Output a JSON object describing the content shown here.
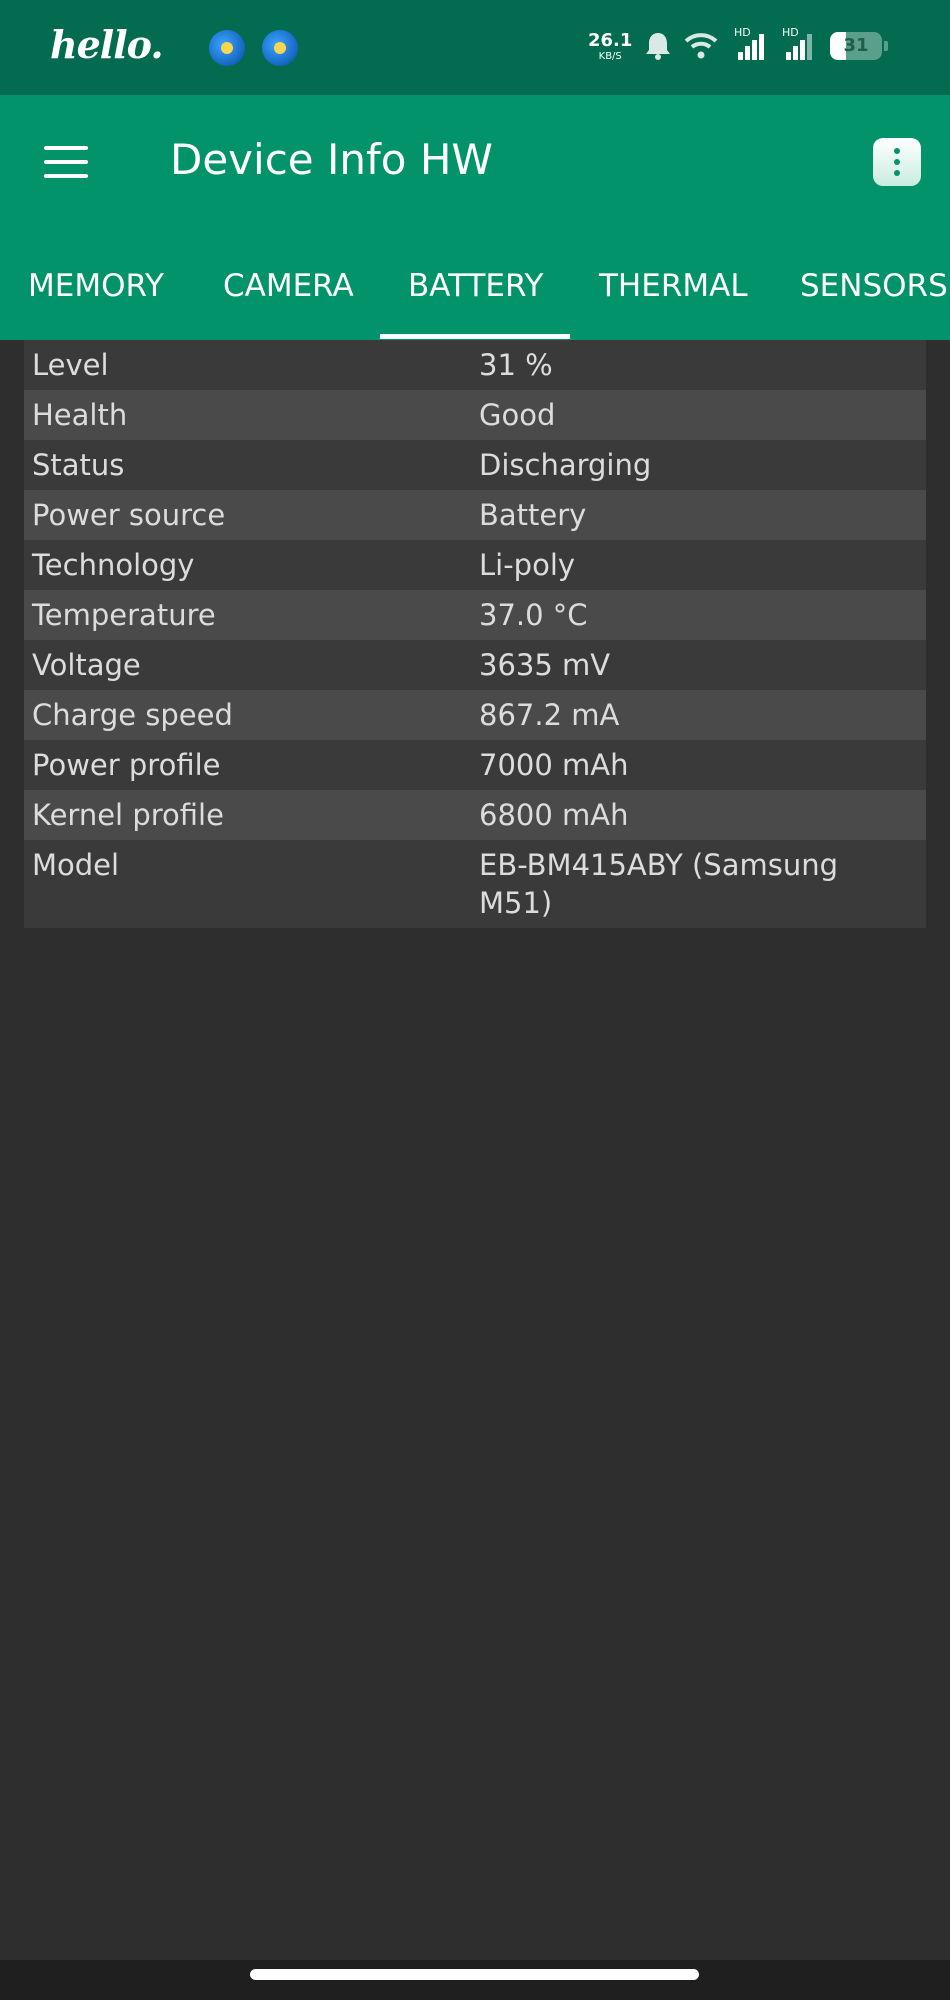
{
  "status_bar": {
    "brand": "hello.",
    "net_speed": "26.1",
    "net_unit": "KB/S",
    "signal_tag_1": "HD",
    "signal_tag_2": "HD",
    "battery_level": "31",
    "icons": [
      "pool-ball-app-icon",
      "pool-ball-app-icon",
      "bell-icon",
      "wifi-icon",
      "signal-icon",
      "signal-icon",
      "battery-icon"
    ]
  },
  "app_bar": {
    "title": "Device Info HW",
    "menu_icon": "hamburger-menu-icon",
    "more_icon": "more-vertical-icon"
  },
  "tabs": [
    "MEMORY",
    "CAMERA",
    "BATTERY",
    "THERMAL",
    "SENSORS"
  ],
  "selected_tab": "BATTERY",
  "battery_info": [
    {
      "label": "Level",
      "value": "31 %"
    },
    {
      "label": "Health",
      "value": "Good"
    },
    {
      "label": "Status",
      "value": "Discharging"
    },
    {
      "label": "Power source",
      "value": "Battery"
    },
    {
      "label": "Technology",
      "value": "Li-poly"
    },
    {
      "label": "Temperature",
      "value": "37.0 °C"
    },
    {
      "label": "Voltage",
      "value": "3635 mV"
    },
    {
      "label": "Charge speed",
      "value": "867.2 mA"
    },
    {
      "label": "Power profile",
      "value": "7000 mAh"
    },
    {
      "label": "Kernel profile",
      "value": "6800 mAh"
    },
    {
      "label": "Model",
      "value": "EB-BM415ABY (Samsung M51)"
    }
  ],
  "colors": {
    "status_bar": "#036b4f",
    "app_bar": "#02936b",
    "background": "#2e2e2e",
    "row_odd": "#3a3a3a",
    "row_even": "#4a4a4a",
    "text": "#dcdcdc"
  }
}
